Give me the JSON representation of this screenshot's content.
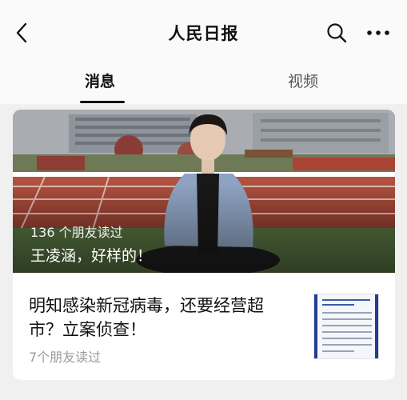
{
  "header": {
    "title": "人民日报",
    "back_icon": "back-arrow-icon",
    "search_icon": "search-icon",
    "more_icon": "more-icon"
  },
  "tabs": [
    {
      "label": "消息",
      "active": true
    },
    {
      "label": "视频",
      "active": false
    }
  ],
  "featured": {
    "readers": "136 个朋友读过",
    "title": "王凌涵，好样的！"
  },
  "article": {
    "title": "明知感染新冠病毒，还要经营超市？立案侦查！",
    "readers": "7个朋友读过"
  },
  "colors": {
    "active_tab": "#111111",
    "inactive_tab": "#555555",
    "accent_blue": "#1f3e8f"
  }
}
